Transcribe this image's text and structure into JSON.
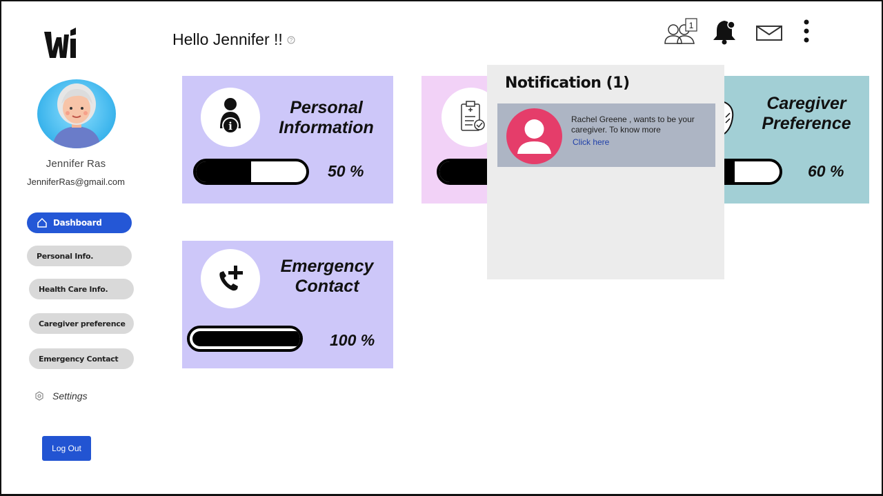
{
  "header": {
    "greeting": "Hello Jennifer !!",
    "notification_count_badge": "1"
  },
  "sidebar": {
    "user_name": "Jennifer Ras",
    "user_email": "JenniferRas@gmail.com",
    "nav": [
      {
        "label": "Dashboard",
        "active": true
      },
      {
        "label": "Personal Info."
      },
      {
        "label": "Health Care Info."
      },
      {
        "label": "Caregiver preference"
      },
      {
        "label": "Emergency Contact"
      }
    ],
    "settings_label": "Settings",
    "logout_label": "Log Out"
  },
  "cards": [
    {
      "title_line1": "Personal",
      "title_line2": "Information",
      "progress": 0.5,
      "percent_label": "50 %",
      "color": "#cdc7f9",
      "icon": "person-info-icon"
    },
    {
      "progress": 0.5,
      "color": "#f2d2f7",
      "icon": "clipboard-check-icon"
    },
    {
      "title_line1": "Caregiver",
      "title_line2": "Preference",
      "progress": 0.6,
      "percent_label": "60 %",
      "color": "#a2cfd5",
      "icon": "handshake-icon"
    },
    {
      "title_line1": "Emergency",
      "title_line2": "Contact",
      "progress": 1.0,
      "percent_label": "100 %",
      "color": "#cdc7f9",
      "icon": "phone-plus-icon"
    }
  ],
  "notification_panel": {
    "title": "Notification (1)",
    "items": [
      {
        "message": "Rachel Greene , wants to be your caregiver. To know more",
        "link_label": "Click here"
      }
    ]
  },
  "colors": {
    "accent": "#2457d6",
    "notification_avatar": "#e53d6a"
  }
}
